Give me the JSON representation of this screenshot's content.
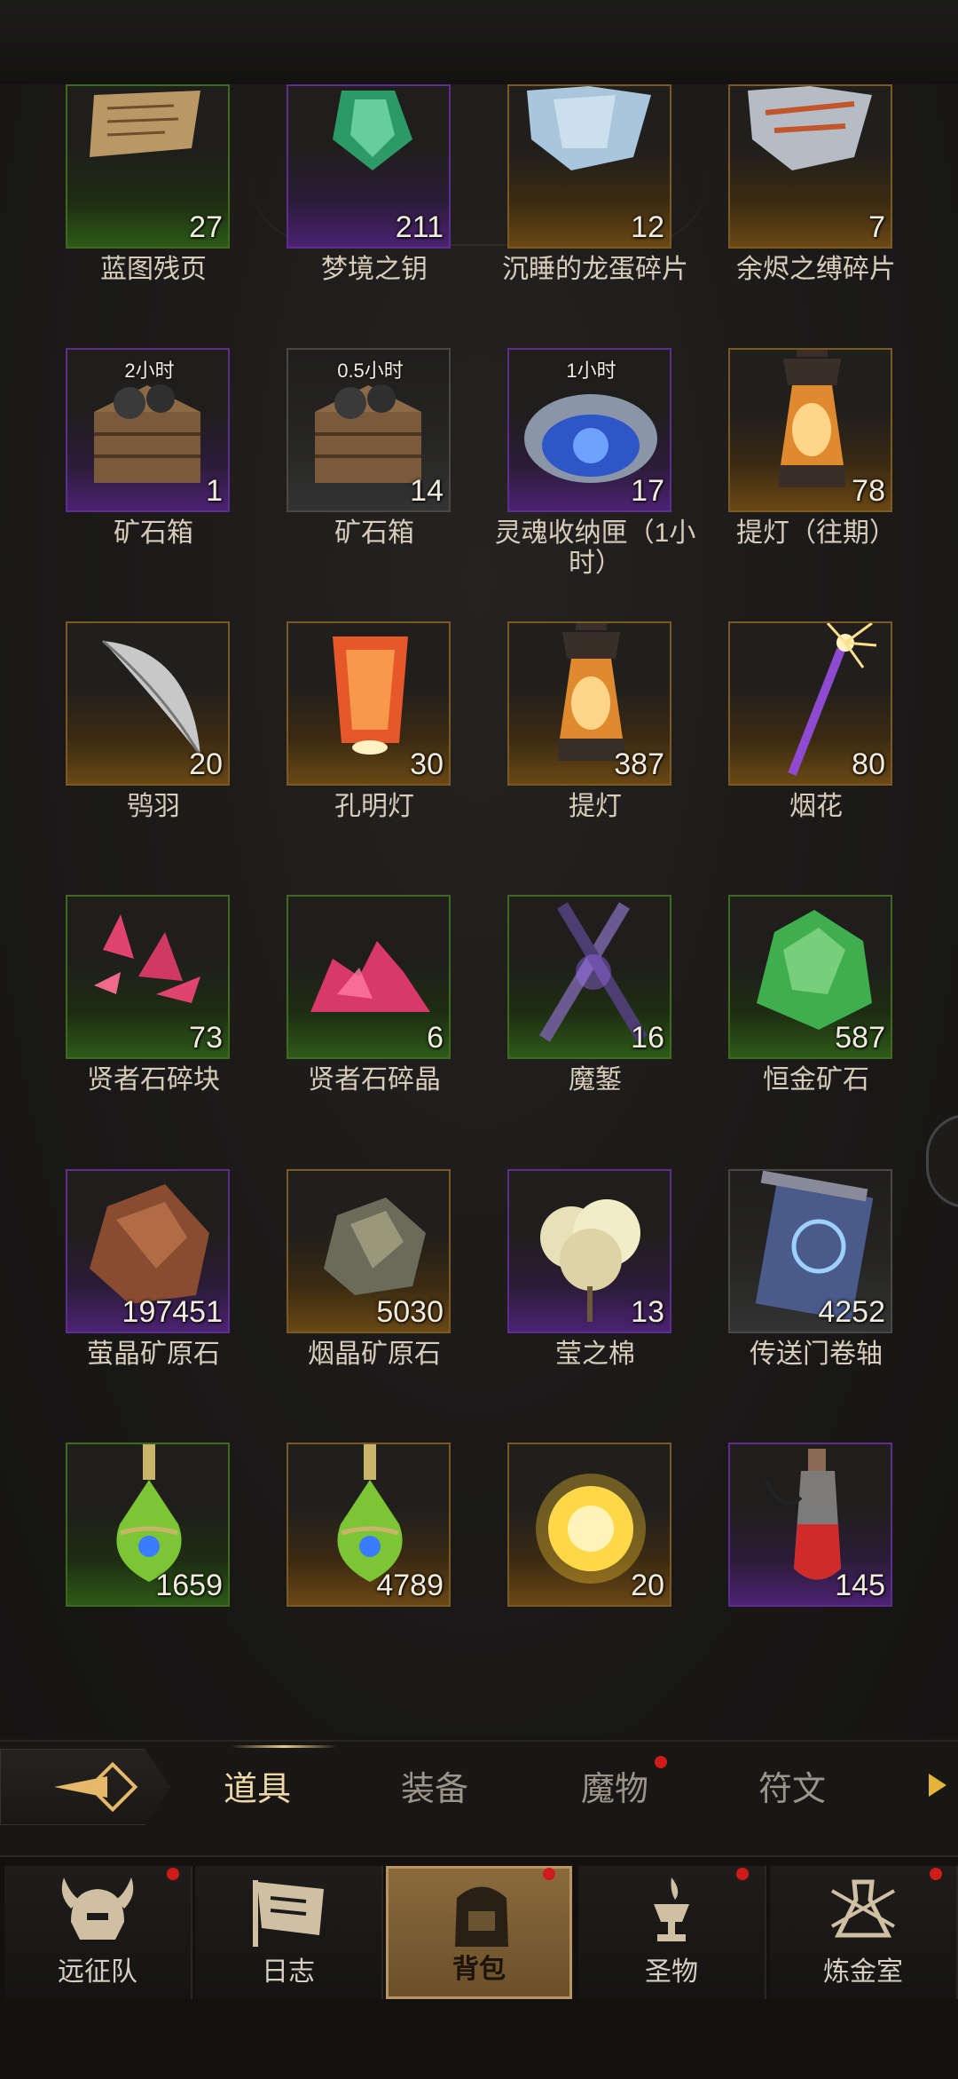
{
  "items": [
    {
      "name": "蓝图残页",
      "count": "27",
      "rarity": "green",
      "icon": "scroll-page-icon"
    },
    {
      "name": "梦境之钥",
      "count": "211",
      "rarity": "purple",
      "icon": "green-lantern-key-icon"
    },
    {
      "name": "沉睡的龙蛋碎片",
      "count": "12",
      "rarity": "orange",
      "icon": "crystal-shard-icon"
    },
    {
      "name": "余烬之缚碎片",
      "count": "7",
      "rarity": "orange",
      "icon": "ember-shard-icon"
    },
    {
      "name": "矿石箱",
      "count": "1",
      "rarity": "purple",
      "timer": "2小时",
      "icon": "ore-crate-icon"
    },
    {
      "name": "矿石箱",
      "count": "14",
      "rarity": "grey",
      "timer": "0.5小时",
      "icon": "ore-crate-icon"
    },
    {
      "name": "灵魂收纳匣（1小时）",
      "count": "17",
      "rarity": "purple",
      "timer": "1小时",
      "icon": "soul-chest-icon"
    },
    {
      "name": "提灯（往期）",
      "count": "78",
      "rarity": "orange",
      "icon": "lantern-icon"
    },
    {
      "name": "鸮羽",
      "count": "20",
      "rarity": "orange",
      "icon": "feather-icon"
    },
    {
      "name": "孔明灯",
      "count": "30",
      "rarity": "orange",
      "icon": "sky-lantern-icon"
    },
    {
      "name": "提灯",
      "count": "387",
      "rarity": "orange",
      "icon": "lantern-icon"
    },
    {
      "name": "烟花",
      "count": "80",
      "rarity": "orange",
      "icon": "sparkler-icon"
    },
    {
      "name": "贤者石碎块",
      "count": "73",
      "rarity": "green",
      "icon": "red-crystal-shards-icon"
    },
    {
      "name": "贤者石碎晶",
      "count": "6",
      "rarity": "green",
      "icon": "red-crystal-pile-icon"
    },
    {
      "name": "魔錾",
      "count": "16",
      "rarity": "green",
      "icon": "crossed-chisels-icon"
    },
    {
      "name": "恒金矿石",
      "count": "587",
      "rarity": "green",
      "icon": "green-ore-icon"
    },
    {
      "name": "萤晶矿原石",
      "count": "197451",
      "rarity": "purple",
      "icon": "brown-ore-icon"
    },
    {
      "name": "烟晶矿原石",
      "count": "5030",
      "rarity": "orange",
      "icon": "smoky-ore-icon"
    },
    {
      "name": "莹之棉",
      "count": "13",
      "rarity": "purple",
      "icon": "cotton-icon"
    },
    {
      "name": "传送门卷轴",
      "count": "4252",
      "rarity": "grey",
      "icon": "portal-scroll-icon"
    },
    {
      "name": "",
      "count": "1659",
      "rarity": "green",
      "icon": "green-potion-icon"
    },
    {
      "name": "",
      "count": "4789",
      "rarity": "orange",
      "icon": "green-potion-icon"
    },
    {
      "name": "",
      "count": "20",
      "rarity": "orange",
      "icon": "golden-orb-icon"
    },
    {
      "name": "",
      "count": "145",
      "rarity": "purple",
      "icon": "red-vial-icon"
    }
  ],
  "tabs": {
    "items": "道具",
    "equipment": "装备",
    "monsters": "魔物",
    "runes": "符文"
  },
  "nav": {
    "expedition": "远征队",
    "journal": "日志",
    "backpack": "背包",
    "relics": "圣物",
    "alchemy": "炼金室"
  }
}
